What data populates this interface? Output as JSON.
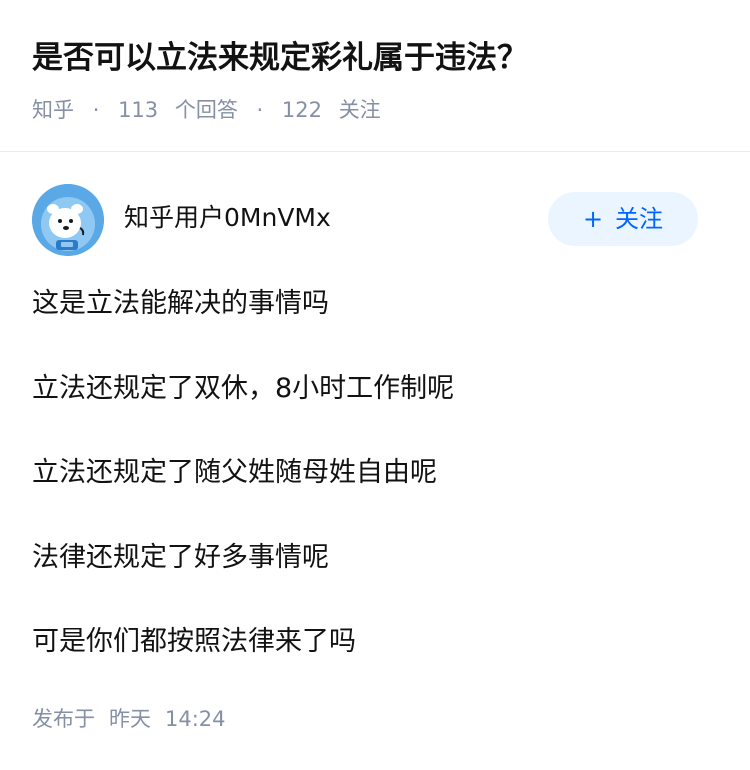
{
  "question": {
    "title": "是否可以立法来规定彩礼属于违法？",
    "source": "知乎",
    "answers_count": "113",
    "answers_label": "个回答",
    "followers_count": "122",
    "followers_label": "关注"
  },
  "author": {
    "name": "知乎用户0MnVMx",
    "avatar_icon": "cartoon-bear-avatar-icon",
    "follow_label": "关注",
    "follow_icon": "+"
  },
  "answer": {
    "paragraphs": [
      "这是立法能解决的事情吗",
      "立法还规定了双休，8小时工作制呢",
      "立法还规定了随父姓随母姓自由呢",
      "法律还规定了好多事情呢",
      "可是你们都按照法律来了吗"
    ]
  },
  "publish": {
    "label": "发布于",
    "date": "昨天",
    "time": "14:24"
  },
  "colors": {
    "meta": "#8590a6",
    "accent": "#0066ff",
    "follow_bg": "#ebf5ff",
    "avatar_bg": "#5aa9e6"
  }
}
